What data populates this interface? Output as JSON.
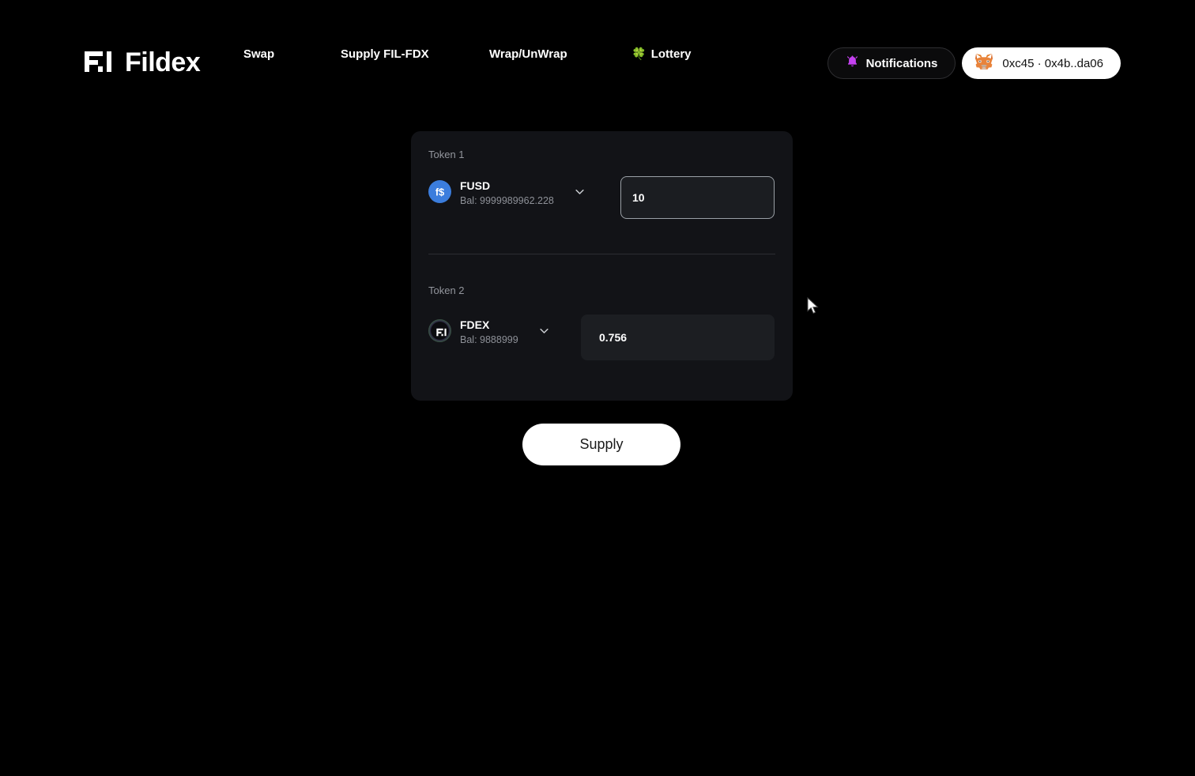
{
  "header": {
    "logo": {
      "mark_icon": "fildex-logo-icon",
      "text": "Fildex"
    },
    "nav_items": [
      {
        "label": "Swap",
        "icon": ""
      },
      {
        "label": "Supply FIL-FDX",
        "icon": ""
      },
      {
        "label": "Wrap/UnWrap",
        "icon": ""
      },
      {
        "label": "Lottery",
        "icon": "🍀"
      }
    ],
    "notifications": {
      "label": "Notifications",
      "icon": "bell-icon",
      "icon_color": "#c541f0"
    },
    "wallet": {
      "label": "0xc45 · 0x4b..da06",
      "icon": "metamask-fox-icon"
    }
  },
  "card": {
    "token1": {
      "section_label": "Token 1",
      "symbol": "FUSD",
      "balance": "Bal: 9999989962.228",
      "icon_text": "f$",
      "icon_color": "#3b7ddd",
      "amount_value": "10",
      "amount_placeholder": "0.0",
      "chevron_icon": "chevron-down-icon"
    },
    "token2": {
      "section_label": "Token 2",
      "symbol": "FDEX",
      "balance": "Bal: 9888999",
      "icon_text": "fildex-logo-icon",
      "icon_color": "#101114",
      "amount_value": "0.756",
      "amount_placeholder": "0.0",
      "chevron_icon": "chevron-down-icon"
    }
  },
  "actions": {
    "supply_label": "Supply"
  },
  "theme": {
    "background": "#000000",
    "card_background": "#121317",
    "accent_white": "#ffffff",
    "muted_text": "#8e9198",
    "divider": "#2b2d32"
  }
}
